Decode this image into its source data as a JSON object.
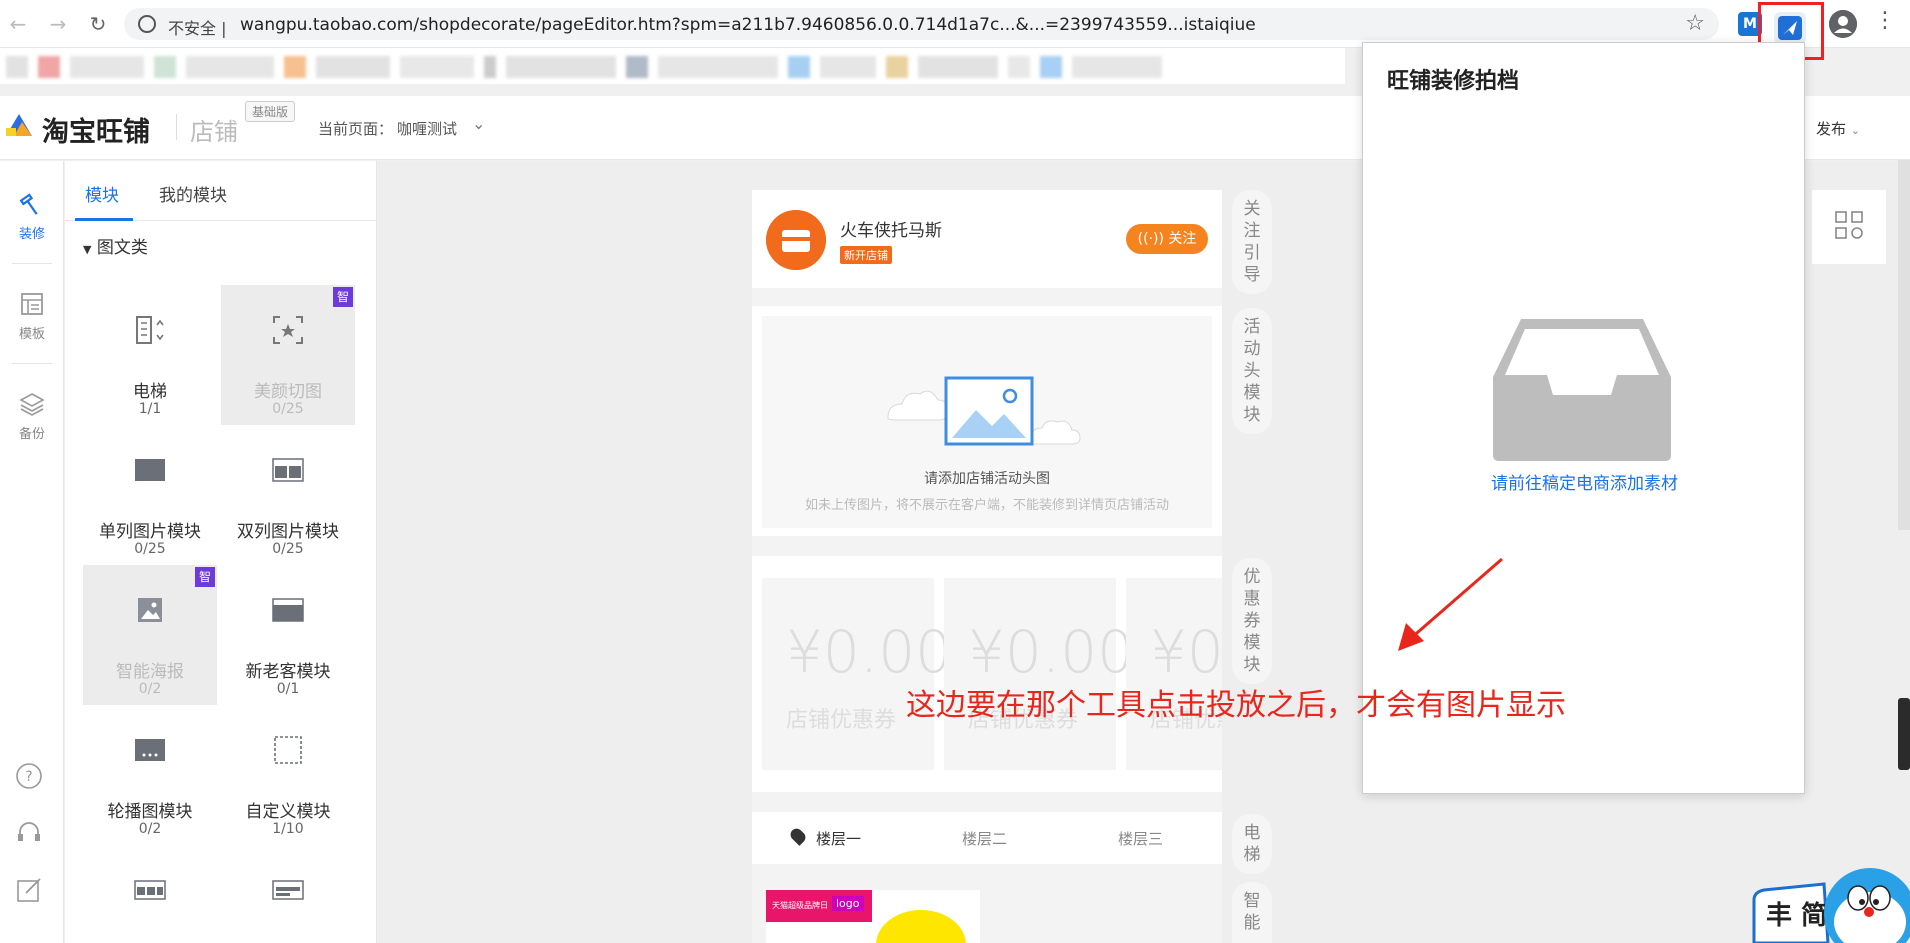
{
  "browser": {
    "insecure_label": "不安全 |",
    "url": "wangpu.taobao.com/shopdecorate/pageEditor.htm?spm=a211b7.9460856.0.0.714d1a7c...&...=2399743559...istaiqiue",
    "extension_m_label": "M"
  },
  "bookmarks": {
    "colors": [
      "#e2e2e2",
      "#f0a6a6",
      "#e6e6e6",
      "#cfe3d6",
      "#e6e6e6",
      "#f6c090",
      "#e2e2e2",
      "#e8e8e8",
      "#cccccc",
      "#e2e2e2",
      "#b0bac8",
      "#e6e6e6",
      "#a6cff2",
      "#e6e6e6",
      "#e8d2a0",
      "#e2e2e2",
      "#e8e8e8",
      "#a8cff4",
      "#e6e6e6"
    ]
  },
  "app": {
    "logo_text": "淘宝旺铺",
    "shop_word": "店铺",
    "edition": "基础版",
    "current_page_label": "当前页面：",
    "current_page_value": "咖喱测试",
    "publish_label": "发布"
  },
  "rail": {
    "items": [
      {
        "label": "装修",
        "icon": "hammer-icon"
      },
      {
        "label": "模板",
        "icon": "template-icon"
      },
      {
        "label": "备份",
        "icon": "layers-icon"
      }
    ],
    "bottom_icons": [
      "help-icon",
      "headset-icon",
      "edit-icon"
    ]
  },
  "panel": {
    "tabs": [
      "模块",
      "我的模块"
    ],
    "category": "图文类",
    "badge_label": "智",
    "modules": [
      {
        "name": "电梯",
        "count": "1/1",
        "icon": "elevator-icon"
      },
      {
        "name": "美颜切图",
        "count": "0/25",
        "icon": "smart-crop-icon"
      },
      {
        "name": "单列图片模块",
        "count": "0/25",
        "icon": "single-image-icon"
      },
      {
        "name": "双列图片模块",
        "count": "0/25",
        "icon": "double-image-icon"
      },
      {
        "name": "智能海报",
        "count": "0/2",
        "icon": "poster-icon"
      },
      {
        "name": "新老客模块",
        "count": "0/1",
        "icon": "customer-module-icon"
      },
      {
        "name": "轮播图模块",
        "count": "0/2",
        "icon": "carousel-icon"
      },
      {
        "name": "自定义模块",
        "count": "1/10",
        "icon": "custom-module-icon"
      }
    ]
  },
  "preview": {
    "shop_name": "火车侠托马斯",
    "shop_tag": "新开店铺",
    "follow_label": "关注",
    "banner_title": "请添加店铺活动头图",
    "banner_subtitle": "如未上传图片，将不展示在客户端，不能装修到详情页店铺活动",
    "coupon_amount": "¥0.00",
    "coupon_label": "店铺优惠券",
    "floors": [
      "楼层一",
      "楼层二",
      "楼层三"
    ],
    "promo_label": "天猫超级品牌日",
    "promo_logo": "logo"
  },
  "section_labels": [
    "关注引导",
    "活动头模块",
    "优惠券模块",
    "电梯",
    "智能"
  ],
  "popup": {
    "title": "旺铺装修拍档",
    "link": "请前往稿定电商添加素材"
  },
  "annotation": "这边要在那个工具点击投放之后，才会有图片显示",
  "mascot_text": "丰 简"
}
